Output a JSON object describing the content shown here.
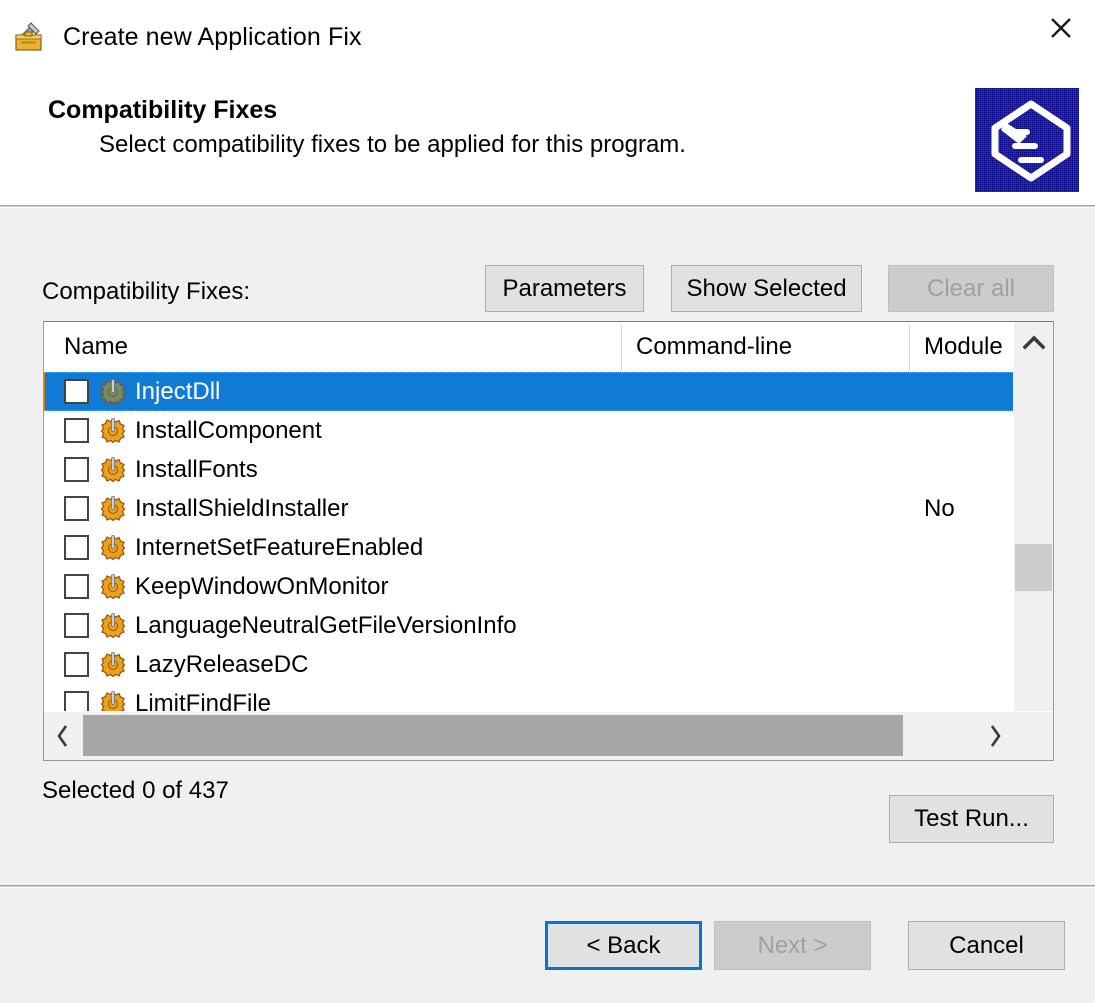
{
  "window": {
    "title": "Create new Application Fix",
    "title_icon": "toolbox-hammer-icon",
    "close_label": "✕"
  },
  "header": {
    "title": "Compatibility Fixes",
    "subtitle": "Select compatibility fixes to be applied for this program.",
    "banner_icon": "compatibility-tray-icon",
    "banner_bg": "#000080"
  },
  "toolbar": {
    "list_label": "Compatibility Fixes:",
    "parameters_label": "Parameters",
    "show_selected_label": "Show Selected",
    "clear_all_label": "Clear all",
    "clear_all_disabled": true
  },
  "list": {
    "columns": [
      "Name",
      "Command-line",
      "Module"
    ],
    "sort_indicator": "^",
    "rows": [
      {
        "name": "InjectDll",
        "commandline": "",
        "module": "",
        "checked": false,
        "selected": true,
        "icon_color": "#6a8f6a"
      },
      {
        "name": "InstallComponent",
        "commandline": "",
        "module": "",
        "checked": false,
        "selected": false,
        "icon_color": "#e8a317"
      },
      {
        "name": "InstallFonts",
        "commandline": "",
        "module": "",
        "checked": false,
        "selected": false,
        "icon_color": "#e8a317"
      },
      {
        "name": "InstallShieldInstaller",
        "commandline": "",
        "module": "No",
        "checked": false,
        "selected": false,
        "icon_color": "#e8a317"
      },
      {
        "name": "InternetSetFeatureEnabled",
        "commandline": "",
        "module": "",
        "checked": false,
        "selected": false,
        "icon_color": "#e8a317"
      },
      {
        "name": "KeepWindowOnMonitor",
        "commandline": "",
        "module": "",
        "checked": false,
        "selected": false,
        "icon_color": "#e8a317"
      },
      {
        "name": "LanguageNeutralGetFileVersionInfo",
        "commandline": "",
        "module": "",
        "checked": false,
        "selected": false,
        "icon_color": "#e8a317"
      },
      {
        "name": "LazyReleaseDC",
        "commandline": "",
        "module": "",
        "checked": false,
        "selected": false,
        "icon_color": "#e8a317"
      },
      {
        "name": "LimitFindFile",
        "commandline": "",
        "module": "",
        "checked": false,
        "selected": false,
        "icon_color": "#e8a317"
      }
    ],
    "scroll_up_glyph": "⌃",
    "scroll_down_glyph": "⌄",
    "scroll_left_glyph": "‹",
    "scroll_right_glyph": "›"
  },
  "status": {
    "selected_text": "Selected 0 of 437",
    "selected_count": 0,
    "total_count": 437,
    "test_run_label": "Test Run..."
  },
  "footer": {
    "back_label": "< Back",
    "next_label": "Next >",
    "cancel_label": "Cancel",
    "next_disabled": true,
    "back_focused": true
  },
  "colors": {
    "selection_blue": "#0f7bd4",
    "focus_blue": "#0078d7",
    "focus_outline_orange": "#e8952c",
    "dialog_bg": "#f0f0f0",
    "button_bg": "#e1e1e1"
  }
}
